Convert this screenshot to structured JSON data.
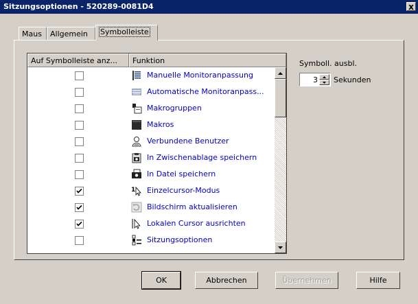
{
  "window": {
    "title": "Sitzungsoptionen - 520289-0081D4",
    "close_label": "x"
  },
  "tabs": [
    {
      "label": "Maus"
    },
    {
      "label": "Allgemein"
    },
    {
      "label": "Symbolleiste"
    }
  ],
  "table": {
    "headers": [
      "Auf Symbolleiste anz...",
      "Funktion"
    ],
    "rows": [
      {
        "checked": false,
        "icon": "monitor-adjust-icon",
        "label": "Manuelle Monitoranpassung"
      },
      {
        "checked": false,
        "icon": "auto-monitor-adjust-icon",
        "label": "Automatische Monitoranpass..."
      },
      {
        "checked": false,
        "icon": "macro-groups-icon",
        "label": "Makrogruppen"
      },
      {
        "checked": false,
        "icon": "macros-icon",
        "label": "Makros"
      },
      {
        "checked": false,
        "icon": "connected-users-icon",
        "label": "Verbundene Benutzer"
      },
      {
        "checked": false,
        "icon": "clipboard-camera-icon",
        "label": "In Zwischenablage speichern"
      },
      {
        "checked": false,
        "icon": "save-file-camera-icon",
        "label": "In Datei speichern"
      },
      {
        "checked": true,
        "icon": "single-cursor-icon",
        "label": "Einzelcursor-Modus"
      },
      {
        "checked": true,
        "icon": "refresh-screen-icon",
        "label": "Bildschirm aktualisieren"
      },
      {
        "checked": true,
        "icon": "align-cursor-icon",
        "label": "Lokalen Cursor ausrichten"
      },
      {
        "checked": false,
        "icon": "session-options-icon",
        "label": "Sitzungsoptionen"
      }
    ]
  },
  "hide_toolbar": {
    "label": "Symboll. ausbl.",
    "value": "3",
    "unit": "Sekunden"
  },
  "buttons": {
    "ok": "OK",
    "cancel": "Abbrechen",
    "apply": "Übernehmen",
    "help": "Hilfe"
  }
}
